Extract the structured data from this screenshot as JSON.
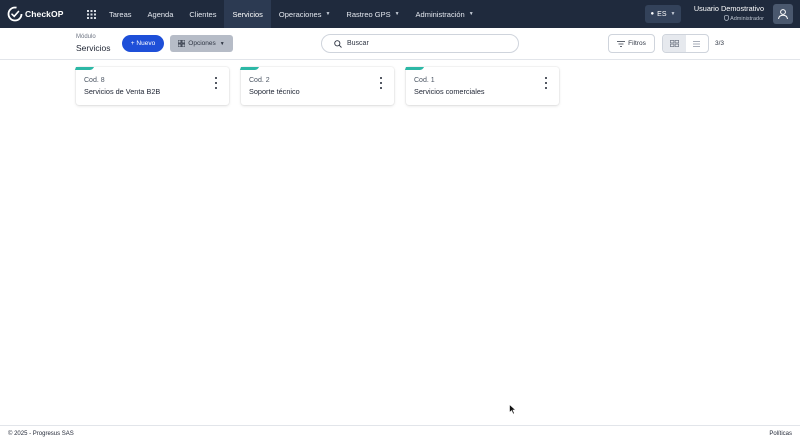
{
  "brand": {
    "name": "CheckOP"
  },
  "nav": {
    "items": [
      {
        "label": "Tareas",
        "dropdown": false
      },
      {
        "label": "Agenda",
        "dropdown": false
      },
      {
        "label": "Clientes",
        "dropdown": false
      },
      {
        "label": "Servicios",
        "dropdown": false,
        "active": true
      },
      {
        "label": "Operaciones",
        "dropdown": true
      },
      {
        "label": "Rastreo GPS",
        "dropdown": true
      },
      {
        "label": "Administración",
        "dropdown": true
      }
    ]
  },
  "language": {
    "code": "ES"
  },
  "user": {
    "name": "Usuario Demostrativo",
    "role": "Administrador"
  },
  "header": {
    "module_label": "Módulo",
    "module_title": "Servicios",
    "new_button": "+ Nuevo",
    "options_button": "Opciones",
    "search_placeholder": "Buscar",
    "filters_button": "Filtros",
    "count": "3/3"
  },
  "cards": [
    {
      "code": "Cod. 8",
      "title": "Servicios de Venta B2B"
    },
    {
      "code": "Cod. 2",
      "title": "Soporte técnico"
    },
    {
      "code": "Cod. 1",
      "title": "Servicios comerciales"
    }
  ],
  "footer": {
    "copyright": "© 2025 - Progresus SAS",
    "policies": "Políticas"
  },
  "colors": {
    "topbar": "#1f2a3d",
    "primary": "#1e4fd8",
    "accent": "#2cb8a6"
  },
  "icons": [
    "checkop-logo-icon",
    "apps-grid-icon",
    "globe-icon",
    "user-icon",
    "grid-view-icon",
    "list-view-icon",
    "search-icon",
    "filter-icon",
    "kebab-menu-icon",
    "shield-icon"
  ]
}
